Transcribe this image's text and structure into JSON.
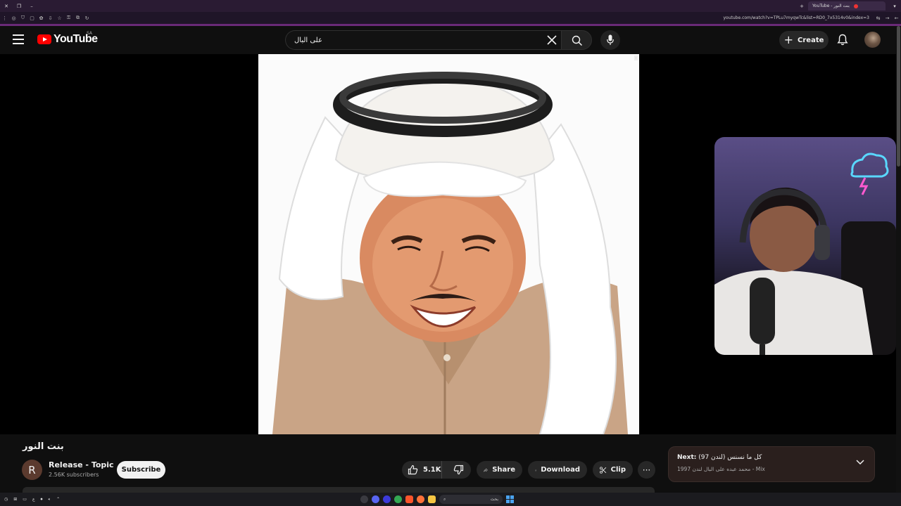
{
  "browser": {
    "tab_title": "YouTube - بنت النور",
    "url": "youtube.com/watch?v=TPLu7myqwTc&list=RD0_7x5314v0&index=3"
  },
  "header": {
    "logo_text": "YouTube",
    "country_code": "SA",
    "search_value": "على البال",
    "create_label": "Create"
  },
  "video": {
    "title": "بنت النور",
    "channel_initial": "R",
    "channel_name": "Release - Topic",
    "subscribers": "2.56K subscribers",
    "subscribe_label": "Subscribe",
    "likes": "5.1K",
    "share_label": "Share",
    "download_label": "Download",
    "clip_label": "Clip",
    "more_label": "···"
  },
  "next": {
    "prefix": "Next:",
    "title": "كل ما نسنس (لندن 97)",
    "subtitle": "محمد عبده على البال لندن 1997 - Mix"
  },
  "taskbar": {
    "search_text": "بحث"
  },
  "colors": {
    "brand_red": "#ff0000",
    "background": "#0f0f0f",
    "pill": "#272727"
  }
}
